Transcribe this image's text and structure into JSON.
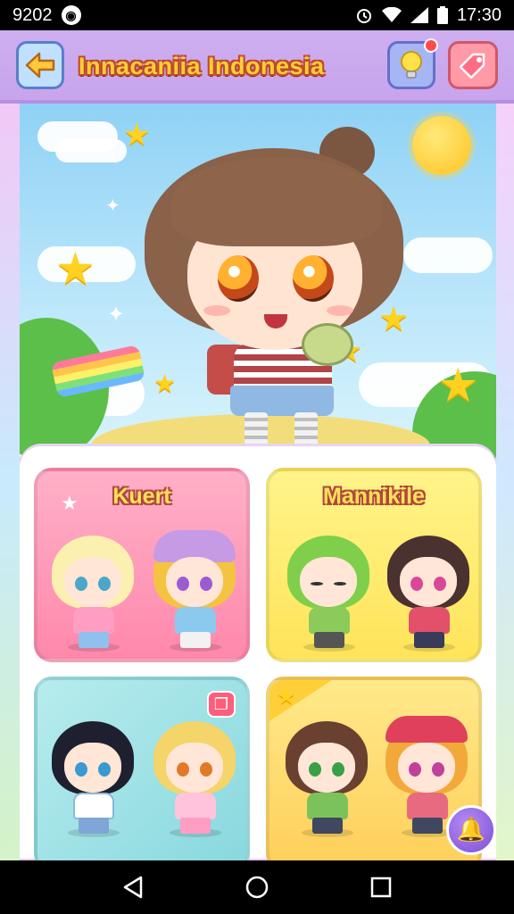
{
  "status_bar": {
    "time_left": "9202",
    "time_right": "17:30",
    "icons": [
      "app-notification-icon",
      "alarm-icon",
      "wifi-icon",
      "signal-icon",
      "battery-icon"
    ]
  },
  "header": {
    "title": "Innacaniia Indonesia",
    "back_icon": "arrow-left-icon",
    "hint_icon": "lightbulb-icon",
    "shop_icon": "shop-tag-icon"
  },
  "cards": [
    {
      "label": "Kuert",
      "color": "#ff9fbc",
      "color2": "#ff7aa6"
    },
    {
      "label": "Mannikile",
      "color": "#fff07a",
      "color2": "#ffe24a"
    },
    {
      "label": "",
      "color": "#a9e6ea",
      "color2": "#7fd4dc",
      "badge": "❐"
    },
    {
      "label": "",
      "color": "#ffe27a",
      "color2": "#ffc94a"
    }
  ],
  "colors": {
    "accent": "#c7a4ec",
    "title_fill": "#ffcf3a",
    "title_outline": "#c04a2a"
  },
  "fab_icon": "bell-icon",
  "nav": {
    "back_icon": "nav-back-icon",
    "home_icon": "nav-home-icon",
    "recents_icon": "nav-recents-icon"
  }
}
